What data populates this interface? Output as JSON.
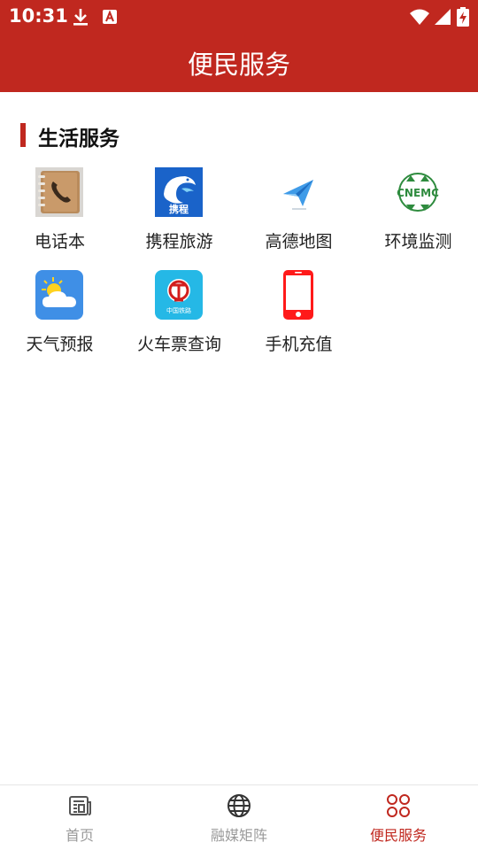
{
  "status_bar": {
    "time": "10:31"
  },
  "header": {
    "title": "便民服务"
  },
  "section": {
    "title": "生活服务"
  },
  "services": [
    {
      "label": "电话本",
      "icon": "phonebook-icon"
    },
    {
      "label": "携程旅游",
      "icon": "ctrip-icon",
      "icon_text": "携程"
    },
    {
      "label": "高德地图",
      "icon": "amap-icon"
    },
    {
      "label": "环境监测",
      "icon": "environment-monitor-icon",
      "icon_text": "CNEMC"
    },
    {
      "label": "天气预报",
      "icon": "weather-icon"
    },
    {
      "label": "火车票查询",
      "icon": "train-ticket-icon",
      "icon_text": "中国铁路"
    },
    {
      "label": "手机充值",
      "icon": "mobile-recharge-icon"
    }
  ],
  "tabs": [
    {
      "label": "首页",
      "icon": "newspaper-icon",
      "active": false
    },
    {
      "label": "融媒矩阵",
      "icon": "globe-icon",
      "active": false
    },
    {
      "label": "便民服务",
      "icon": "grid-icon",
      "active": true
    }
  ],
  "colors": {
    "primary": "#c0281f",
    "tab_inactive": "#9a9a9a"
  }
}
